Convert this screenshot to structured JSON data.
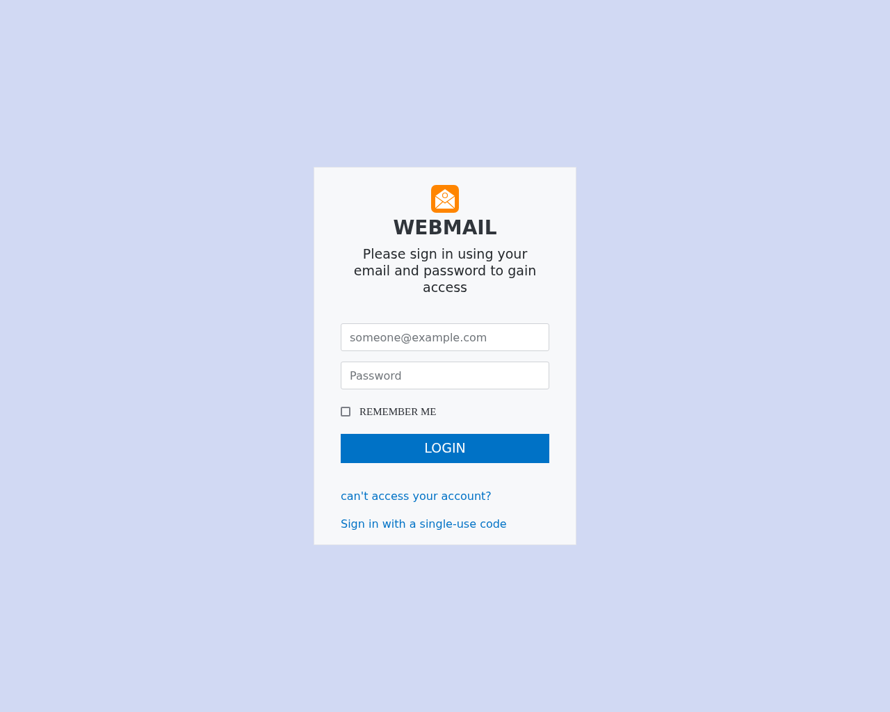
{
  "app": {
    "title": "WEBMAIL",
    "subtitle": "Please sign in using your email and password to gain access"
  },
  "email_field": {
    "placeholder": "someone@example.com"
  },
  "password_field": {
    "placeholder": "Password"
  },
  "remember_me": {
    "label": "REMEMBER ME",
    "checked": false
  },
  "login_button": {
    "label": "LOGIN"
  },
  "links": [
    {
      "label": "can't access your account?"
    },
    {
      "label": "Sign in with a single-use code"
    }
  ]
}
